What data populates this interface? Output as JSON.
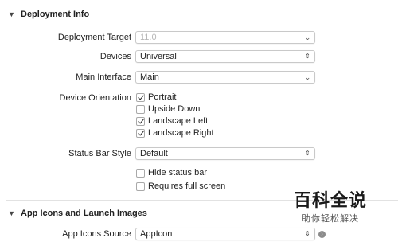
{
  "deployment": {
    "title": "Deployment Info",
    "target_label": "Deployment Target",
    "target_value": "11.0",
    "devices_label": "Devices",
    "devices_value": "Universal",
    "main_interface_label": "Main Interface",
    "main_interface_value": "Main",
    "orientation_label": "Device Orientation",
    "orientations": [
      {
        "label": "Portrait",
        "checked": true
      },
      {
        "label": "Upside Down",
        "checked": false
      },
      {
        "label": "Landscape Left",
        "checked": true
      },
      {
        "label": "Landscape Right",
        "checked": true
      }
    ],
    "status_bar_label": "Status Bar Style",
    "status_bar_value": "Default",
    "hide_status_bar": {
      "label": "Hide status bar",
      "checked": false
    },
    "requires_full_screen": {
      "label": "Requires full screen",
      "checked": false
    }
  },
  "app_icons": {
    "title": "App Icons and Launch Images",
    "source_label": "App Icons Source",
    "source_value": "AppIcon"
  },
  "watermark": {
    "big": "百科全说",
    "small": "助你轻松解决"
  },
  "icons": {
    "disclosure": "disclosure-triangle-icon",
    "dropdown": "chevron-down-icon",
    "popup": "up-down-arrows-icon",
    "go": "arrow-circle-icon"
  }
}
